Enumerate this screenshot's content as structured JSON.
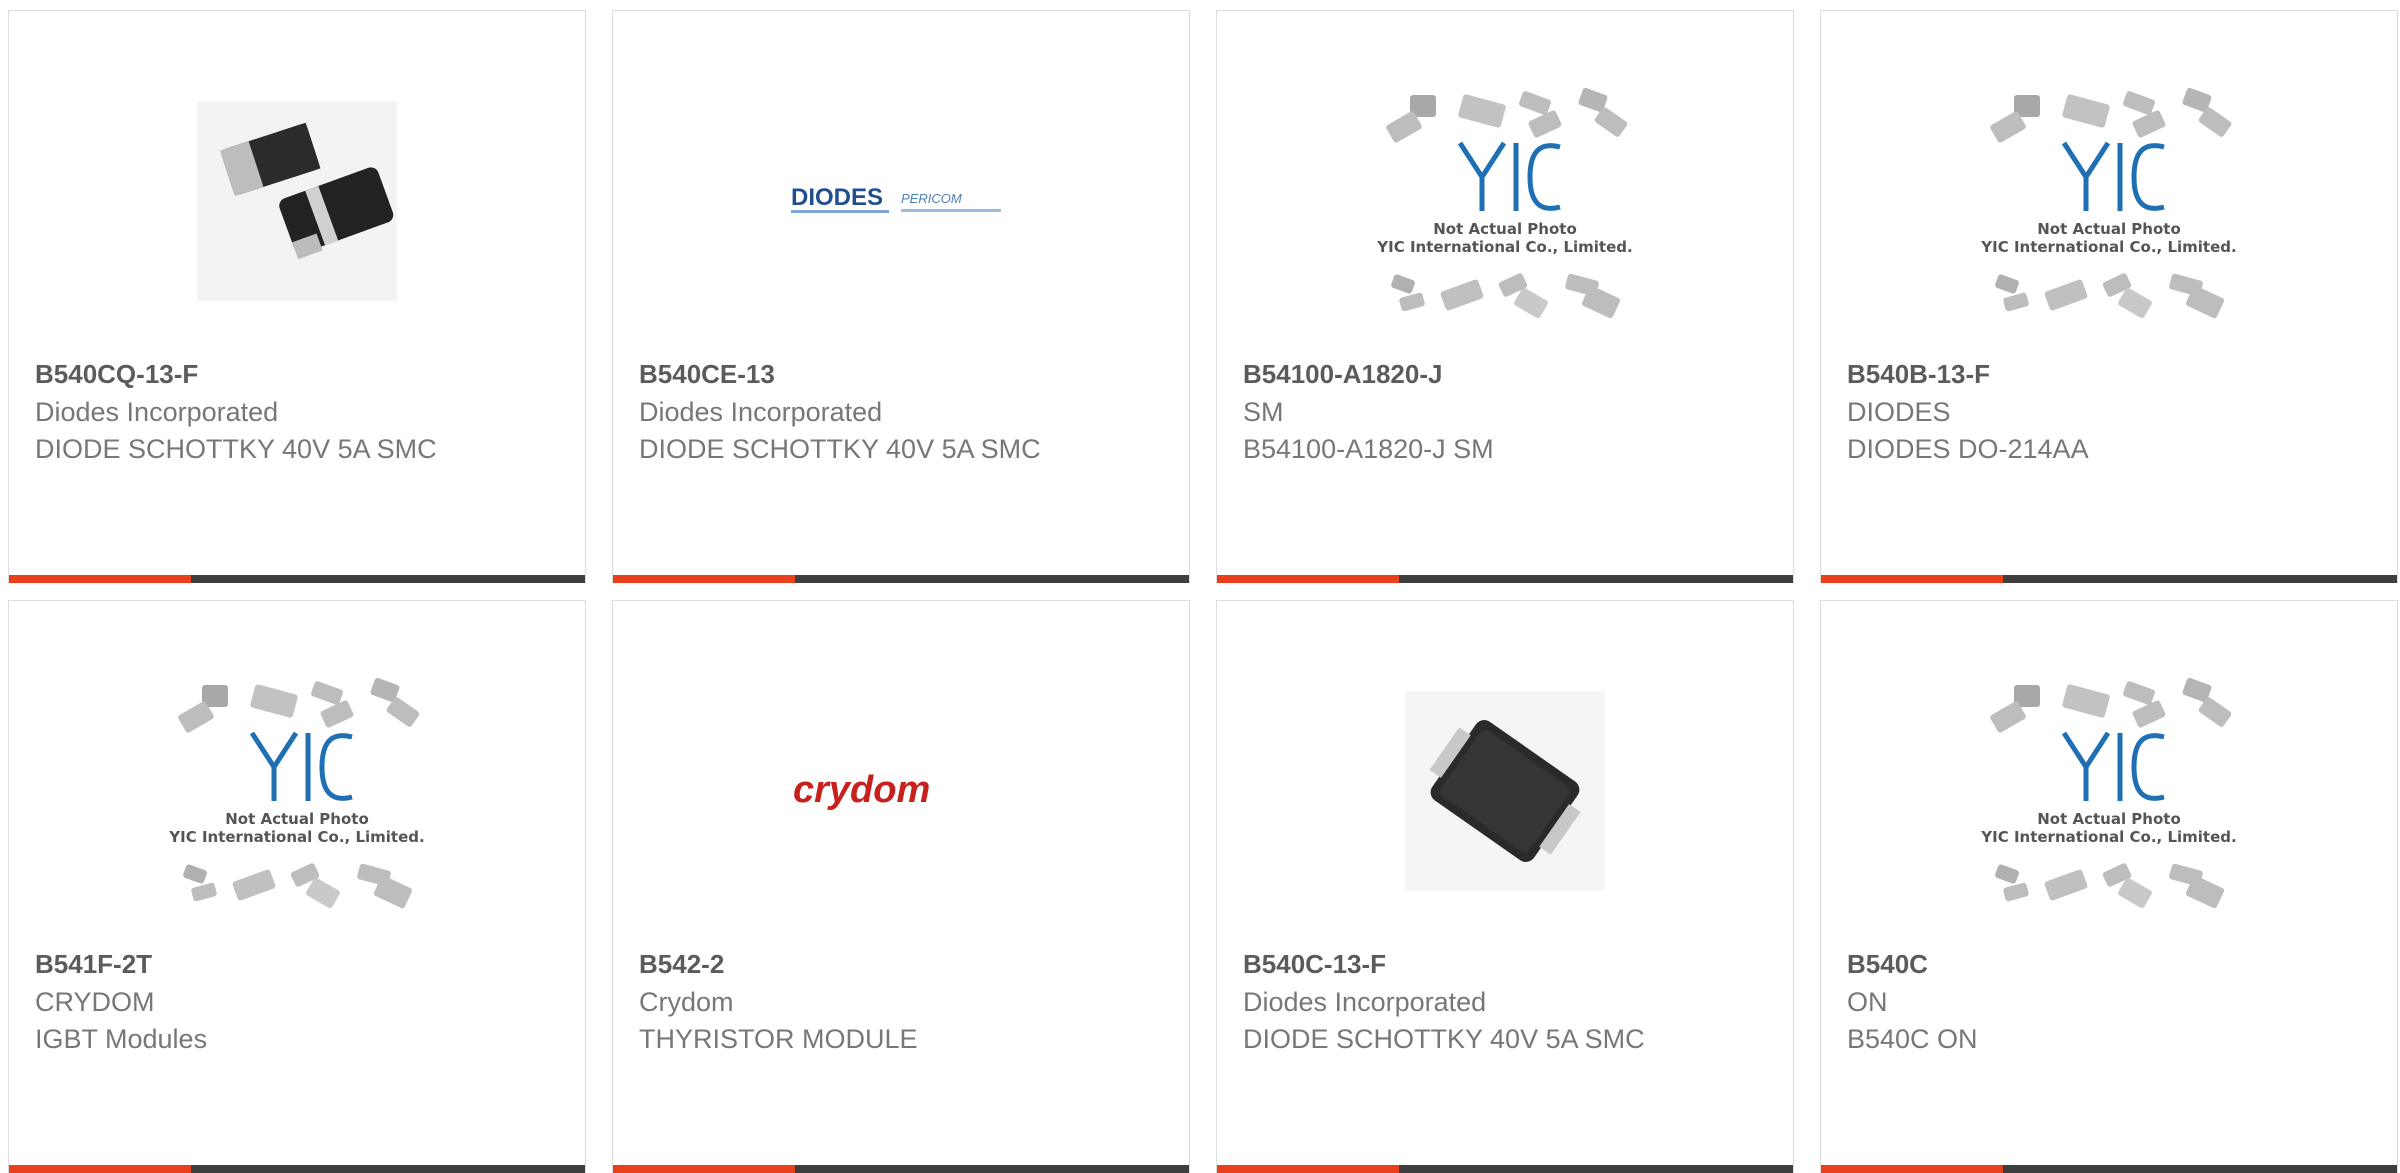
{
  "products": [
    {
      "part": "B540CQ-13-F",
      "manufacturer": "Diodes Incorporated",
      "description": "DIODE SCHOTTKY 40V 5A SMC",
      "image": "smc-diode-pair-photo"
    },
    {
      "part": "B540CE-13",
      "manufacturer": "Diodes Incorporated",
      "description": "DIODE SCHOTTKY 40V 5A SMC",
      "image": "diodes-pericom-logo",
      "logo_text": "DIODES",
      "logo_sub": "PERICOM"
    },
    {
      "part": "B54100-A1820-J",
      "manufacturer": "SM",
      "description": "B54100-A1820-J SM",
      "image": "yic-placeholder"
    },
    {
      "part": "B540B-13-F",
      "manufacturer": "DIODES",
      "description": "DIODES DO-214AA",
      "image": "yic-placeholder"
    },
    {
      "part": "B541F-2T",
      "manufacturer": "CRYDOM",
      "description": "IGBT Modules",
      "image": "yic-placeholder"
    },
    {
      "part": "B542-2",
      "manufacturer": "Crydom",
      "description": "THYRISTOR MODULE",
      "image": "crydom-logo",
      "logo_text": "crydom"
    },
    {
      "part": "B540C-13-F",
      "manufacturer": "Diodes Incorporated",
      "description": "DIODE SCHOTTKY 40V 5A SMC",
      "image": "smc-diode-photo"
    },
    {
      "part": "B540C",
      "manufacturer": "ON",
      "description": "B540C ON",
      "image": "yic-placeholder"
    }
  ],
  "placeholder": {
    "brand": "YIC",
    "line1": "Not Actual Photo",
    "line2": "YIC International Co., Limited."
  },
  "colors": {
    "accent": "#e8401c",
    "bar": "#3e3e3e",
    "brand_blue": "#1f6fb5",
    "crydom_red": "#c8201c"
  }
}
